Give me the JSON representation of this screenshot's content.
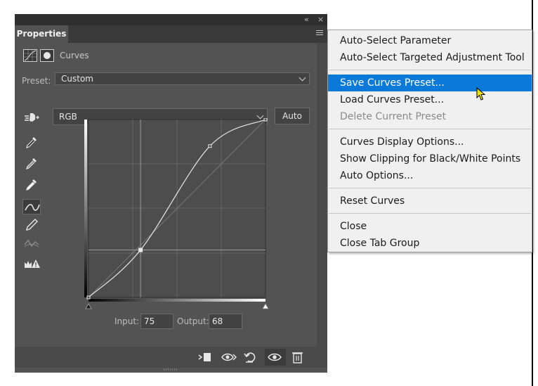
{
  "panel": {
    "tab_label": "Properties",
    "collapse_glyph": "«",
    "close_glyph": "×",
    "adjustment_title": "Curves"
  },
  "preset": {
    "label": "Preset:",
    "value": "Custom"
  },
  "channel": {
    "value": "RGB",
    "auto_label": "Auto"
  },
  "tools": [
    {
      "icon": "on-image-adjust-icon"
    },
    {
      "icon": "black-point-eyedropper-icon"
    },
    {
      "icon": "gray-point-eyedropper-icon"
    },
    {
      "icon": "white-point-eyedropper-icon"
    },
    {
      "icon": "curve-point-tool-icon",
      "selected": true
    },
    {
      "icon": "pencil-icon"
    },
    {
      "icon": "smooth-curve-icon",
      "disabled": true
    },
    {
      "icon": "clipping-warning-icon"
    }
  ],
  "curve": {
    "points": [
      [
        0,
        0
      ],
      [
        75,
        68
      ],
      [
        175,
        217
      ],
      [
        255,
        255
      ]
    ]
  },
  "io": {
    "input_label": "Input:",
    "input_value": "75",
    "output_label": "Output:",
    "output_value": "68"
  },
  "footer_icons": [
    "clip-to-layer-icon",
    "view-previous-state-icon",
    "reset-adjustment-icon",
    "toggle-visibility-icon",
    "delete-adjustment-icon"
  ],
  "menu": {
    "groups": [
      {
        "items": [
          {
            "label": "Auto-Select Parameter"
          },
          {
            "label": "Auto-Select Targeted Adjustment Tool"
          }
        ]
      },
      {
        "items": [
          {
            "label": "Save Curves Preset...",
            "highlighted": true
          },
          {
            "label": "Load Curves Preset..."
          },
          {
            "label": "Delete Current Preset",
            "disabled": true
          }
        ]
      },
      {
        "items": [
          {
            "label": "Curves Display Options..."
          },
          {
            "label": "Show Clipping for Black/White Points"
          },
          {
            "label": "Auto Options..."
          }
        ]
      },
      {
        "items": [
          {
            "label": "Reset Curves"
          }
        ]
      },
      {
        "items": [
          {
            "label": "Close"
          },
          {
            "label": "Close Tab Group"
          }
        ]
      }
    ]
  },
  "colors": {
    "highlight": "#0a79d8",
    "panel_bg": "#535353",
    "graph_bg": "#4d4d4d"
  }
}
